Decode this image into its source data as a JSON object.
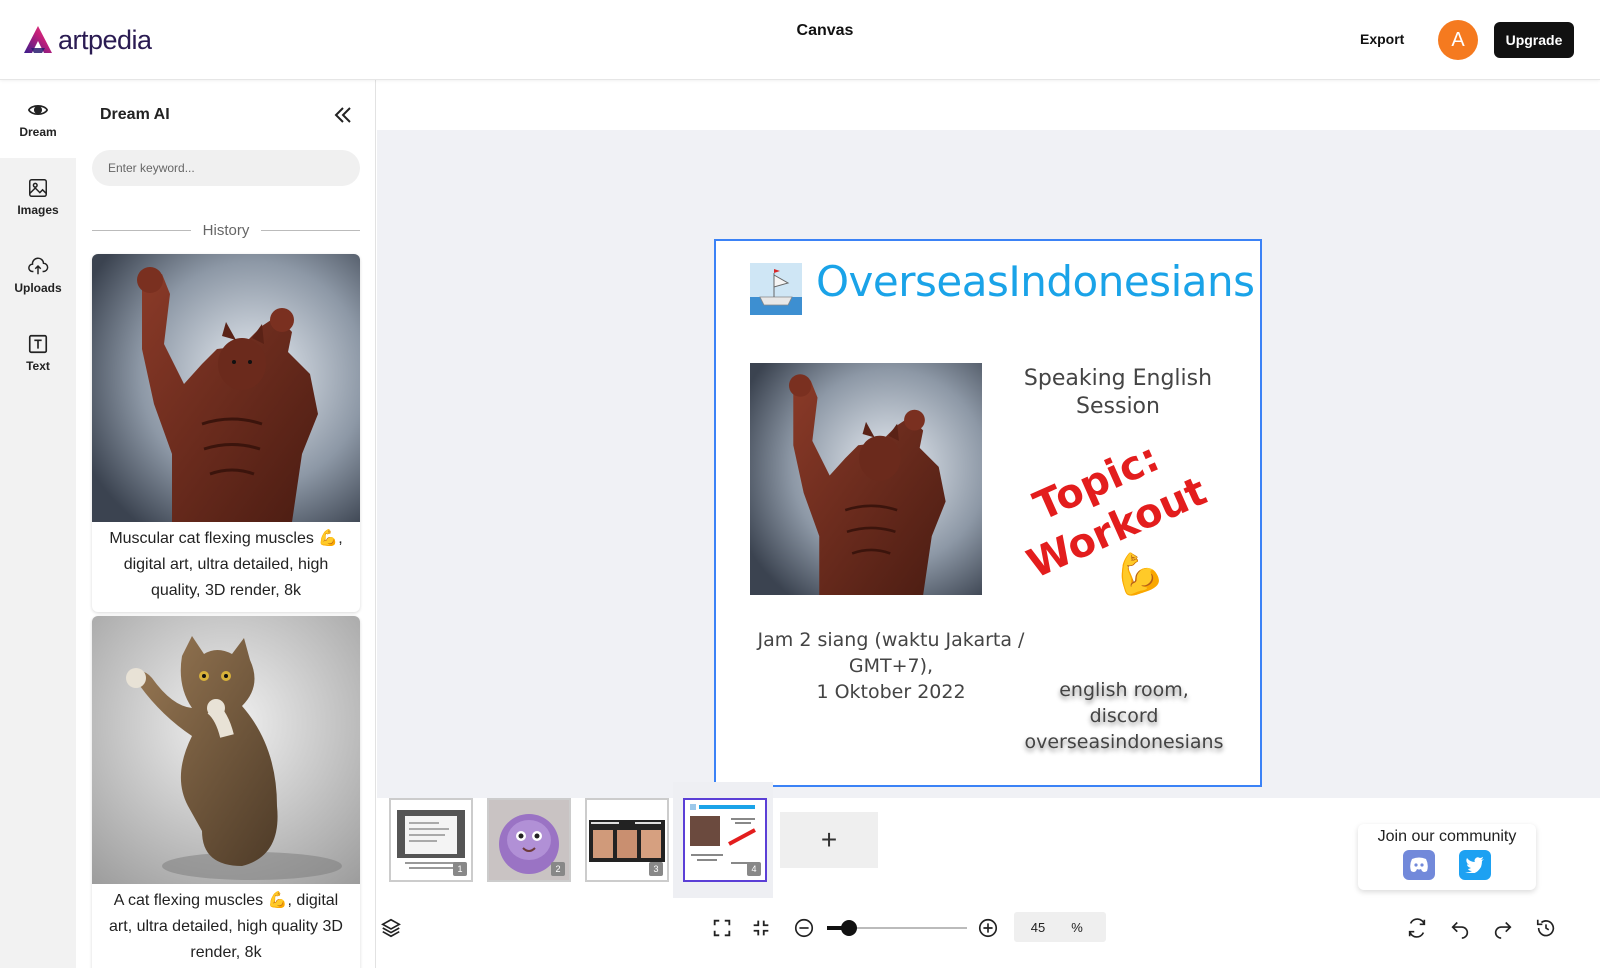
{
  "header": {
    "brand": "artpedia",
    "title": "Canvas",
    "export_label": "Export",
    "avatar_initial": "A",
    "upgrade_label": "Upgrade"
  },
  "rail": {
    "items": [
      {
        "label": "Dream",
        "icon": "eye-icon"
      },
      {
        "label": "Images",
        "icon": "image-icon"
      },
      {
        "label": "Uploads",
        "icon": "cloud-upload-icon"
      },
      {
        "label": "Text",
        "icon": "text-icon"
      }
    ]
  },
  "panel": {
    "title": "Dream AI",
    "search_placeholder": "Enter keyword...",
    "history_label": "History",
    "history": [
      {
        "caption": "Muscular cat flexing muscles 💪, digital art, ultra detailed, high quality, 3D render, 8k"
      },
      {
        "caption": "A cat flexing muscles 💪, digital art, ultra detailed, high quality 3D render, 8k"
      }
    ]
  },
  "canvas": {
    "title": "OverseasIndonesians",
    "session": "Speaking English Session",
    "topic_line1": "Topic:",
    "topic_line2": "Workout 💪",
    "time_line1": "Jam 2 siang (waktu Jakarta /",
    "time_line2": "GMT+7),",
    "time_line3": "1 Oktober 2022",
    "room_line1": "english room,",
    "room_line2": "discord",
    "room_line3": "overseasindonesians"
  },
  "thumbnails": [
    {
      "number": "1"
    },
    {
      "number": "2"
    },
    {
      "number": "3"
    },
    {
      "number": "4",
      "active": true
    }
  ],
  "add_page_label": "+",
  "community": {
    "title": "Join our community",
    "discord_color": "#7289da",
    "twitter_color": "#1da1f2"
  },
  "zoom": {
    "value": "45",
    "unit": "%",
    "level_fraction": 0.12
  },
  "colors": {
    "accent": "#3b82f6",
    "brand_purple": "#5b3fd6",
    "avatar": "#f57a1f",
    "title_blue": "#1aa3e8",
    "topic_red": "#e31d1d"
  }
}
